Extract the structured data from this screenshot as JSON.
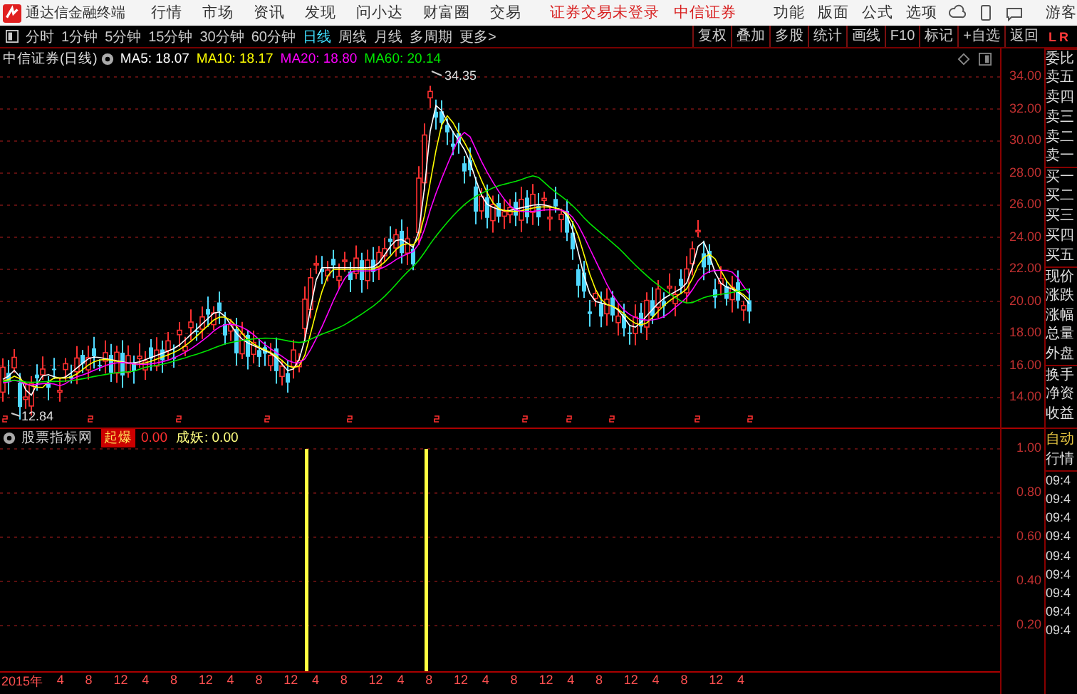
{
  "menu_bar": {
    "app_title": "通达信金融终端",
    "menus": [
      "行情",
      "市场",
      "资讯",
      "发现",
      "问小达",
      "财富圈",
      "交易"
    ],
    "login_status": "证券交易未登录",
    "broker": "中信证券",
    "tools": [
      "功能",
      "版面",
      "公式",
      "选项"
    ],
    "user": "游客"
  },
  "period_tabs": [
    {
      "label": "分时",
      "selected": false
    },
    {
      "label": "1分钟",
      "selected": false
    },
    {
      "label": "5分钟",
      "selected": false
    },
    {
      "label": "15分钟",
      "selected": false
    },
    {
      "label": "30分钟",
      "selected": false
    },
    {
      "label": "60分钟",
      "selected": false
    },
    {
      "label": "日线",
      "selected": true
    },
    {
      "label": "周线",
      "selected": false
    },
    {
      "label": "月线",
      "selected": false
    },
    {
      "label": "多周期",
      "selected": false
    },
    {
      "label": "更多>",
      "selected": false
    }
  ],
  "tool_buttons": [
    "复权",
    "叠加",
    "多股",
    "统计",
    "画线",
    "F10",
    "标记",
    "+自选",
    "返回"
  ],
  "side_toggle": [
    "L",
    "R"
  ],
  "price_chart": {
    "title": "中信证券(日线)",
    "averages": [
      {
        "label": "MA5: 18.07",
        "color": "#ffffff"
      },
      {
        "label": "MA10: 18.17",
        "color": "#ffff00"
      },
      {
        "label": "MA20: 18.80",
        "color": "#ff00ff"
      },
      {
        "label": "MA60: 20.14",
        "color": "#00e600"
      }
    ],
    "y_ticks": [
      "34.00",
      "32.00",
      "30.00",
      "28.00",
      "26.00",
      "24.00",
      "22.00",
      "20.00",
      "18.00",
      "16.00",
      "14.00"
    ],
    "high_label": "34.35",
    "low_label": "12.84"
  },
  "indicator": {
    "name": "股票指标网",
    "badge": "起爆",
    "badge_value": "0.00",
    "series_label": "成妖: 0.00",
    "y_ticks": [
      "1.00",
      "0.80",
      "0.60",
      "0.40",
      "0.20"
    ]
  },
  "date_axis": [
    "2015年",
    "4",
    "8",
    "12",
    "4",
    "8",
    "12",
    "4",
    "8",
    "12",
    "4",
    "8",
    "12",
    "4",
    "8",
    "12",
    "4",
    "8",
    "12",
    "4",
    "8",
    "12",
    "4",
    "8",
    "12",
    "4"
  ],
  "quote_panel": {
    "fields": [
      "委比",
      "卖五",
      "卖四",
      "卖三",
      "卖二",
      "卖一",
      "买一",
      "买二",
      "买三",
      "买四",
      "买五",
      "现价",
      "涨跌",
      "涨幅",
      "总量",
      "外盘",
      "换手",
      "净资",
      "收益"
    ],
    "mode": "自动",
    "section": "行情",
    "times": [
      "09:4",
      "09:4",
      "09:4",
      "09:4",
      "09:4",
      "09:4",
      "09:4",
      "09:4",
      "09:4"
    ]
  }
}
